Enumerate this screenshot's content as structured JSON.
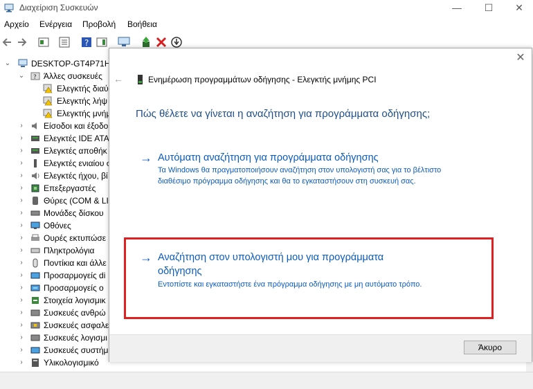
{
  "window": {
    "title": "Διαχείριση Συσκευών"
  },
  "menu": [
    "Αρχείο",
    "Ενέργεια",
    "Προβολή",
    "Βοήθεια"
  ],
  "tree": {
    "root": "DESKTOP-GT4P71H",
    "other_devices": "Άλλες συσκευές",
    "other_children": [
      "Ελεγκτής διαύ",
      "Ελεγκτής λήψ",
      "Ελεγκτής μνήμ"
    ],
    "categories": [
      "Είσοδοι και έξοδοι",
      "Ελεγκτές IDE ATA/",
      "Ελεγκτές αποθήκ",
      "Ελεγκτές ενιαίου σ",
      "Ελεγκτές ήχου, βί",
      "Επεξεργαστές",
      "Θύρες (COM & LI",
      "Μονάδες δίσκου",
      "Οθόνες",
      "Ουρές εκτυπώσε",
      "Πληκτρολόγια",
      "Ποντίκια και άλλε",
      "Προσαρμογείς di",
      "Προσαρμογείς ο",
      "Στοιχεία λογισμικ",
      "Συσκευές ανθρώ",
      "Συσκευές ασφαλε",
      "Συσκευές λογισμι",
      "Συσκευές συστήμ",
      "Υλικολογισμικό"
    ]
  },
  "dialog": {
    "title": "Ενημέρωση προγραμμάτων οδήγησης - Ελεγκτής μνήμης PCI",
    "question": "Πώς θέλετε να γίνεται η αναζήτηση για προγράμματα οδήγησης;",
    "option_auto": {
      "title": "Αυτόματη αναζήτηση για προγράμματα οδήγησης",
      "description": "Τα Windows θα πραγματοποιήσουν αναζήτηση στον υπολογιστή σας για το βέλτιστο διαθέσιμο πρόγραμμα οδήγησης και θα το εγκαταστήσουν στη συσκευή σας."
    },
    "option_browse": {
      "title": "Αναζήτηση στον υπολογιστή μου για προγράμματα οδήγησης",
      "description": "Εντοπίστε και εγκαταστήστε ένα πρόγραμμα οδήγησης με μη αυτόματο τρόπο."
    },
    "cancel_label": "Άκυρο"
  },
  "colors": {
    "link": "#0a5bbf",
    "question": "#1e4e8c",
    "highlight": "#e02020"
  }
}
